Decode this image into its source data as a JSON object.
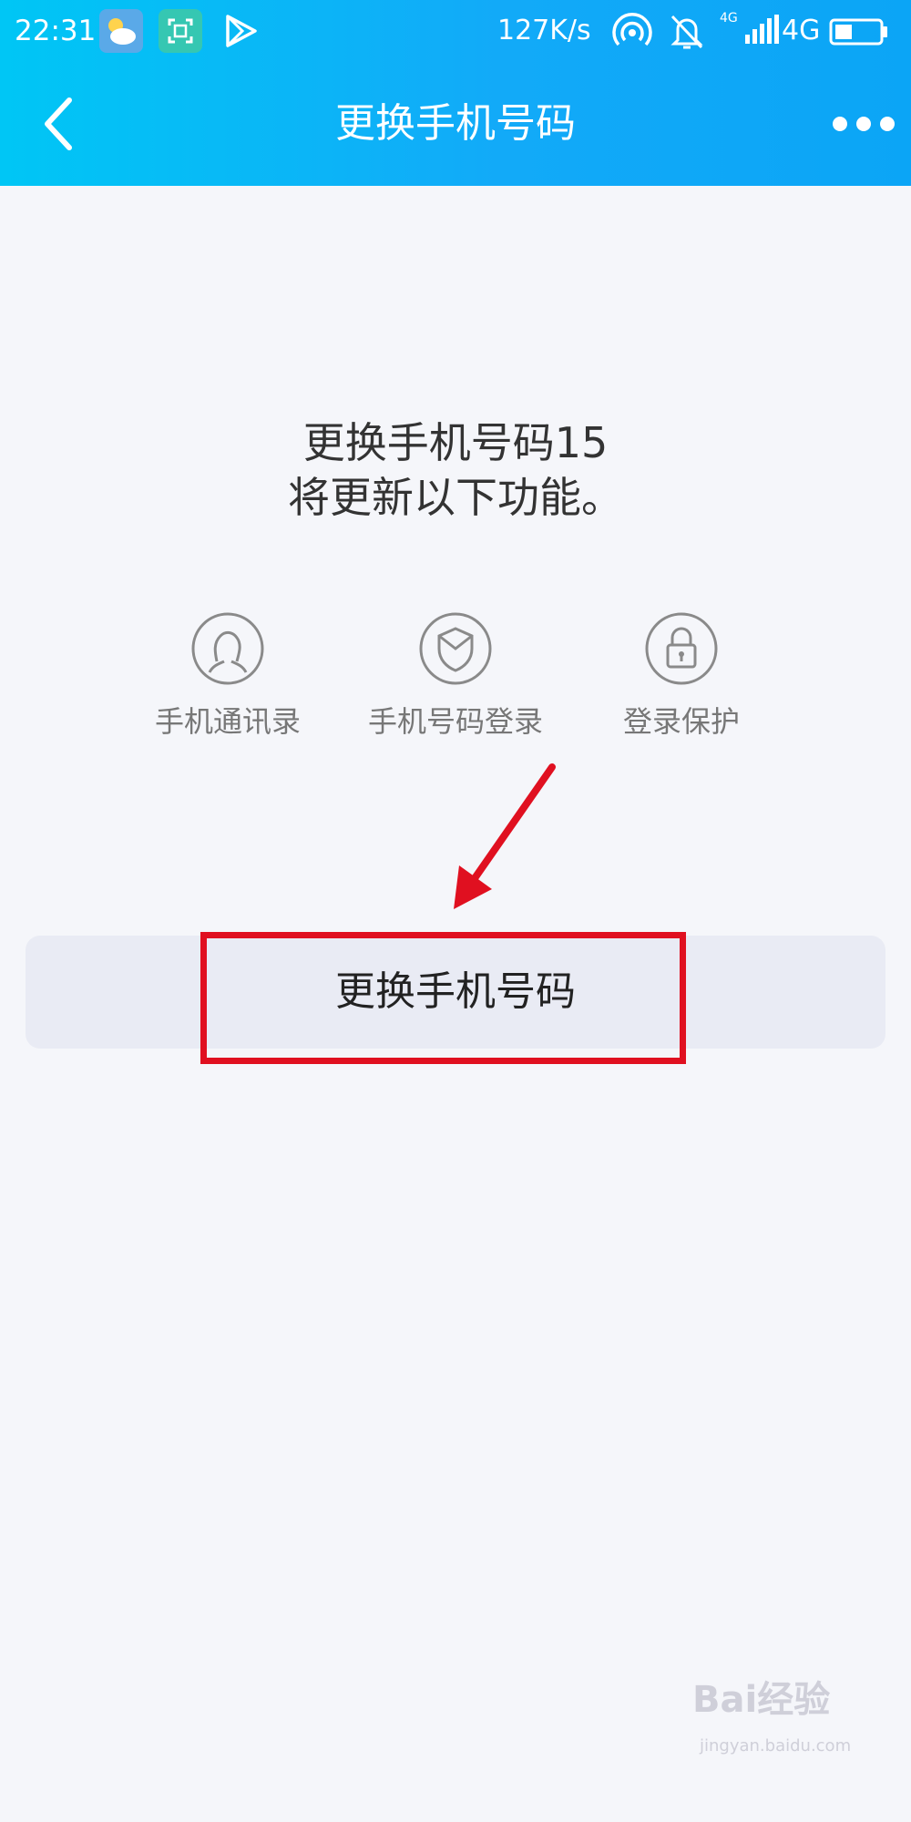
{
  "status_bar": {
    "time": "22:31",
    "speed": "127K/s",
    "network_small": "4G",
    "network": "4G",
    "icons": [
      "weather-icon",
      "scan-icon",
      "play-icon",
      "hotspot-icon",
      "bell-off-icon",
      "signal-icon",
      "battery-icon"
    ]
  },
  "header": {
    "title": "更换手机号码",
    "back_icon": "back-icon",
    "more_icon": "more-icon"
  },
  "intro": {
    "line1": "更换手机号码15",
    "line2": "将更新以下功能。"
  },
  "features": [
    {
      "label": "手机通讯录",
      "icon": "contact-icon"
    },
    {
      "label": "手机号码登录",
      "icon": "shield-icon"
    },
    {
      "label": "登录保护",
      "icon": "lock-icon"
    }
  ],
  "change_button": {
    "label": "更换手机号码"
  },
  "watermark": {
    "brand": "Bai经验",
    "sub": "jingyan.baidu.com"
  },
  "colors": {
    "header_gradient_start": "#00c6f5",
    "header_gradient_end": "#0ba5f6",
    "background": "#f5f6fa",
    "button_bg": "#e9ebf4",
    "annotation_red": "#e01020"
  }
}
